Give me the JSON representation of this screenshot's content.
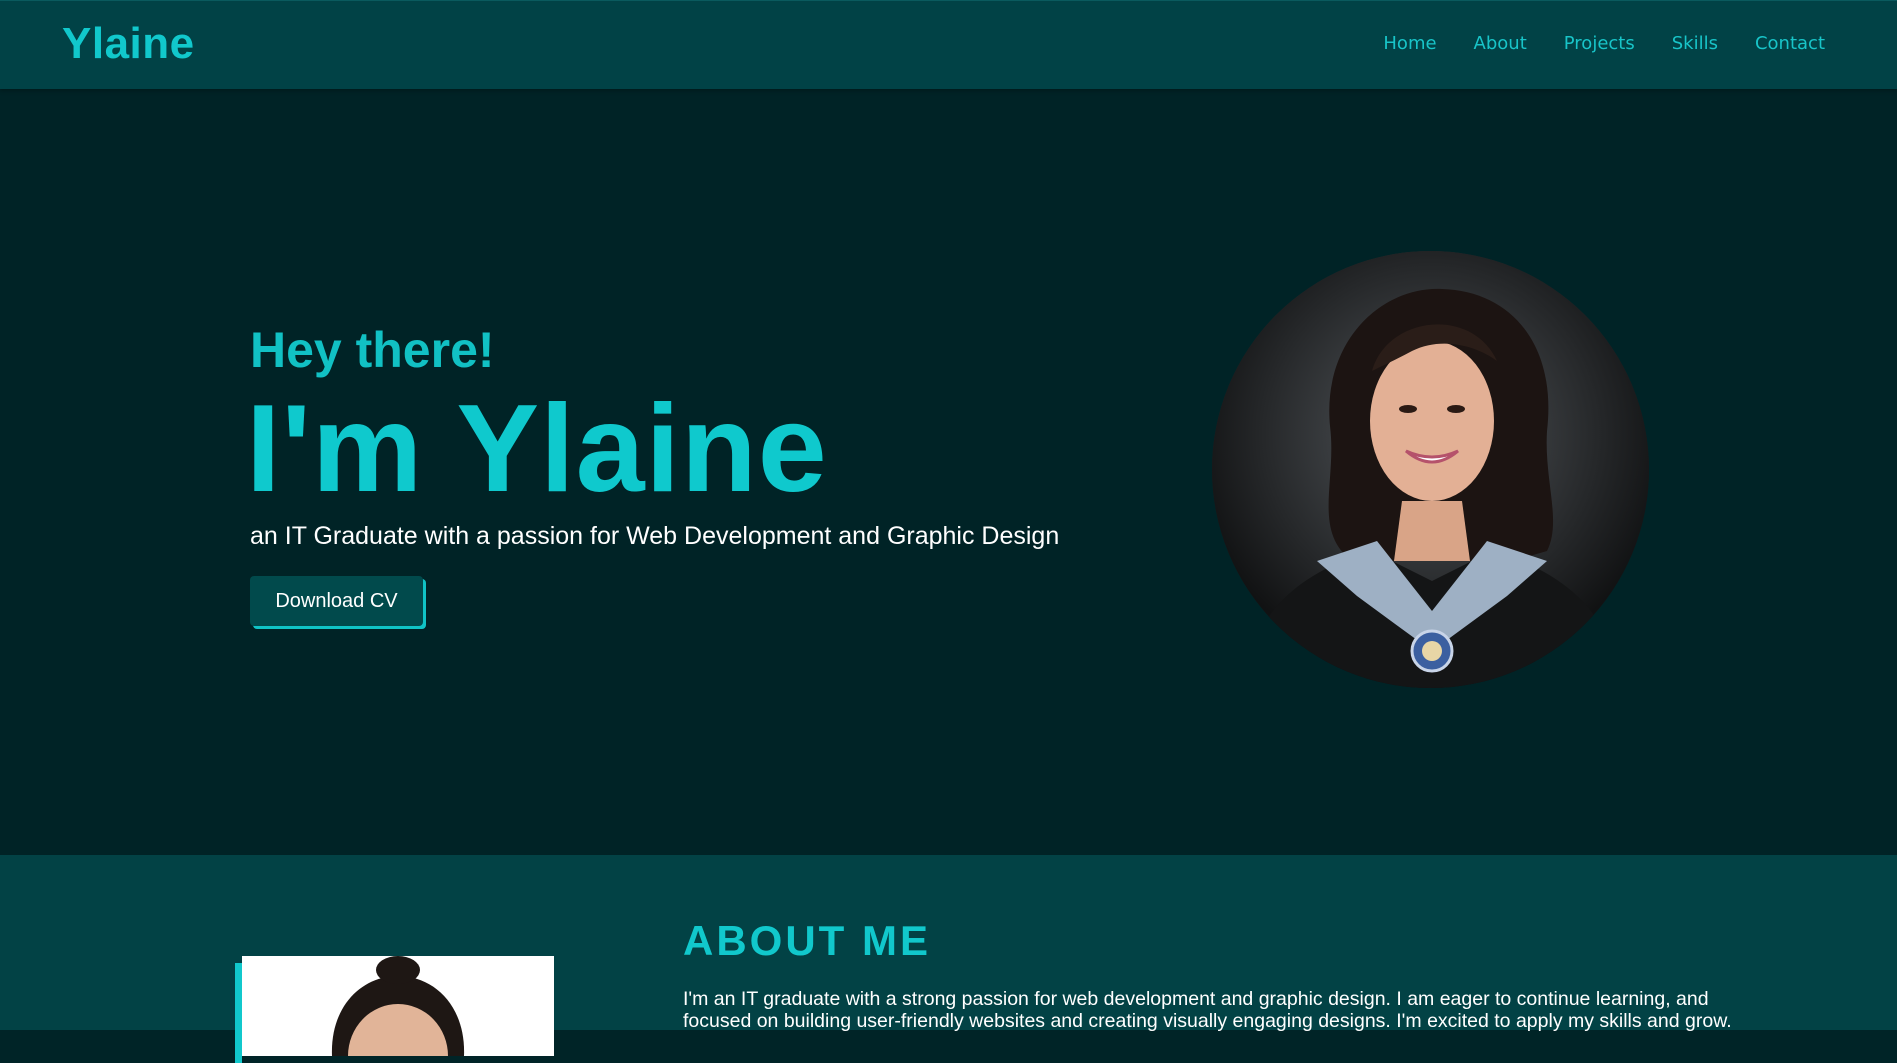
{
  "header": {
    "logo": "Ylaine",
    "nav": [
      "Home",
      "About",
      "Projects",
      "Skills",
      "Contact"
    ]
  },
  "hero": {
    "greeting": "Hey there!",
    "name": "I'm Ylaine",
    "tagline": "an IT Graduate with a passion for Web Development and Graphic Design",
    "button_label": "Download CV"
  },
  "about": {
    "title": "ABOUT ME",
    "paragraph": "I'm an IT graduate with a strong passion for web development and graphic design. I am eager to continue learning, and focused on building user-friendly websites and creating visually engaging designs. I'm excited to apply my skills and grow."
  },
  "colors": {
    "accent": "#11c8cc",
    "header_bg": "#014246",
    "hero_bg": "#002326",
    "about_bg": "#024245"
  }
}
